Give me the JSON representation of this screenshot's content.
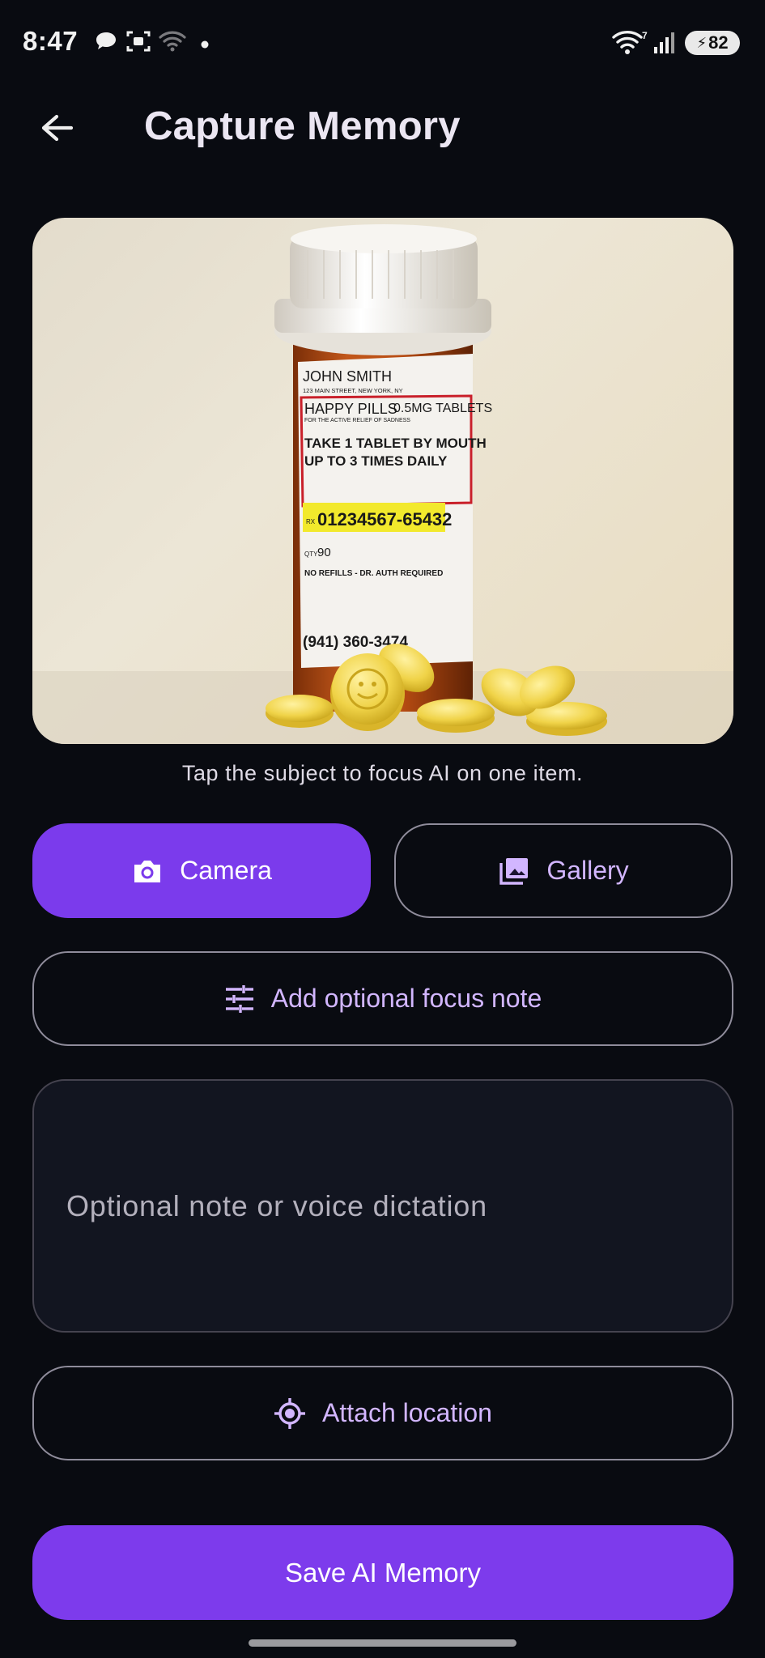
{
  "status_bar": {
    "time": "8:47",
    "battery": "82",
    "icons": [
      "chat-bubble-icon",
      "screenshot-icon",
      "wifi-off-icon",
      "dot-icon",
      "wifi-icon",
      "signal-icon",
      "battery-icon"
    ]
  },
  "header": {
    "back_icon": "arrow-left-icon",
    "title": "Capture Memory"
  },
  "photo": {
    "label_name": "JOHN SMITH",
    "label_address": "123 MAIN STREET, NEW YORK, NY",
    "label_drug": "HAPPY PILLS",
    "label_dose": "0.5MG TABLETS",
    "label_purpose": "FOR THE ACTIVE RELIEF OF SADNESS",
    "label_directions_1": "TAKE 1 TABLET BY MOUTH",
    "label_directions_2": "UP TO 3 TIMES DAILY",
    "label_rx_prefix": "RX",
    "label_rx": "01234567-65432",
    "label_qty_prefix": "QTY",
    "label_qty": "90",
    "label_refills": "NO REFILLS - DR. AUTH REQUIRED",
    "label_phone": "(941) 360-3474"
  },
  "hint": "Tap the subject to focus AI on one item.",
  "actions": {
    "camera_label": "Camera",
    "gallery_label": "Gallery",
    "focus_note_label": "Add optional focus note",
    "note_placeholder": "Optional note or voice dictation",
    "location_label": "Attach location",
    "save_label": "Save AI Memory"
  },
  "colors": {
    "background": "#090b11",
    "primary": "#7b3bec",
    "accent_text": "#d2b6ff"
  }
}
